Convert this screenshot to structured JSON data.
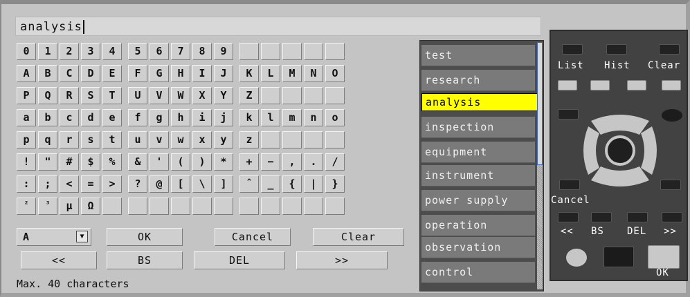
{
  "input": {
    "value": "analysis"
  },
  "keyboard": {
    "rows": [
      [
        [
          "0",
          "1",
          "2",
          "3",
          "4"
        ],
        [
          "5",
          "6",
          "7",
          "8",
          "9"
        ],
        [
          "",
          "",
          "",
          "",
          ""
        ]
      ],
      [
        [
          "A",
          "B",
          "C",
          "D",
          "E"
        ],
        [
          "F",
          "G",
          "H",
          "I",
          "J"
        ],
        [
          "K",
          "L",
          "M",
          "N",
          "O"
        ]
      ],
      [
        [
          "P",
          "Q",
          "R",
          "S",
          "T"
        ],
        [
          "U",
          "V",
          "W",
          "X",
          "Y"
        ],
        [
          "Z",
          "",
          "",
          "",
          ""
        ]
      ],
      [
        [
          "a",
          "b",
          "c",
          "d",
          "e"
        ],
        [
          "f",
          "g",
          "h",
          "i",
          "j"
        ],
        [
          "k",
          "l",
          "m",
          "n",
          "o"
        ]
      ],
      [
        [
          "p",
          "q",
          "r",
          "s",
          "t"
        ],
        [
          "u",
          "v",
          "w",
          "x",
          "y"
        ],
        [
          "z",
          "",
          "",
          "",
          ""
        ]
      ],
      [
        [
          "!",
          "\"",
          "#",
          "$",
          "%"
        ],
        [
          "&",
          "'",
          "(",
          ")",
          "*"
        ],
        [
          "+",
          "−",
          ",",
          ".",
          "/"
        ]
      ],
      [
        [
          ":",
          ";",
          "<",
          "=",
          ">"
        ],
        [
          "?",
          "@",
          "[",
          "\\",
          "]"
        ],
        [
          "ˆ",
          "_",
          "{",
          "|",
          "}"
        ]
      ],
      [
        [
          "²",
          "³",
          "μ",
          "Ω",
          ""
        ],
        [
          "",
          "",
          "",
          "",
          ""
        ],
        [
          "",
          "",
          "",
          "",
          ""
        ]
      ]
    ]
  },
  "controls": {
    "charset_value": "A",
    "ok_label": "OK",
    "cancel_label": "Cancel",
    "clear_label": "Clear",
    "left_label": "<<",
    "bs_label": "BS",
    "del_label": "DEL",
    "right_label": ">>"
  },
  "max_label": "Max. 40 characters",
  "history": {
    "items": [
      "test",
      "research",
      "analysis",
      "inspection",
      "equipment",
      "instrument",
      "power supply",
      "operation",
      "observation",
      "control"
    ],
    "selected_index": 2
  },
  "remote": {
    "list_label": "List",
    "hist_label": "Hist",
    "clear_label": "Clear",
    "cancel_label": "Cancel",
    "left_label": "<<",
    "bs_label": "BS",
    "del_label": "DEL",
    "right_label": ">>",
    "ok_label": "OK"
  }
}
